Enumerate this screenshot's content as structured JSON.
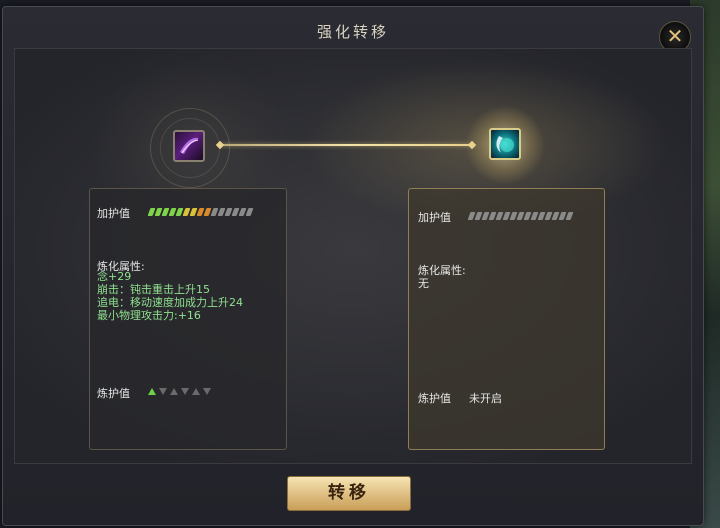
{
  "dialog": {
    "title": "强化转移",
    "close_label": "✕"
  },
  "left_card": {
    "protect_label": "加护值",
    "protect_pips": {
      "filled": 9,
      "total": 15
    },
    "refine_label": "炼化属性:",
    "refine_lines": [
      "念+29",
      "崩击：钝击重击上升15",
      "追电：移动速度加成力上升24",
      "最小物理攻击力:+16"
    ],
    "forge_label": "炼护值",
    "forge_active": 1,
    "forge_total": 6
  },
  "right_card": {
    "protect_label": "加护值",
    "protect_pips": {
      "filled": 0,
      "total": 15
    },
    "refine_label": "炼化属性:",
    "refine_value": "无",
    "forge_label": "炼护值",
    "forge_value": "未开启"
  },
  "transfer_button": "转移",
  "colors": {
    "accent_gold": "#e8d18c",
    "attribute_green": "#8fe08f"
  }
}
